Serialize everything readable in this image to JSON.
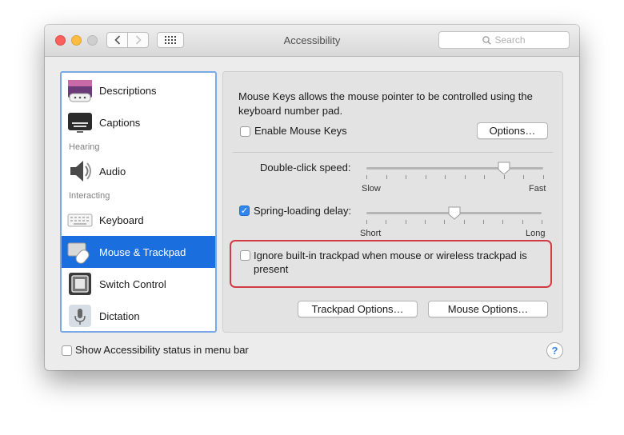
{
  "window": {
    "title": "Accessibility",
    "search_placeholder": "Search"
  },
  "sidebar": {
    "items": [
      {
        "label": "Descriptions",
        "icon": "descriptions-icon"
      },
      {
        "label": "Captions",
        "icon": "captions-icon"
      },
      {
        "label": "Audio",
        "icon": "speaker-icon"
      },
      {
        "label": "Keyboard",
        "icon": "keyboard-icon"
      },
      {
        "label": "Mouse & Trackpad",
        "icon": "mouse-trackpad-icon",
        "selected": true
      },
      {
        "label": "Switch Control",
        "icon": "switch-control-icon"
      },
      {
        "label": "Dictation",
        "icon": "microphone-icon"
      }
    ],
    "sections": {
      "hearing": "Hearing",
      "interacting": "Interacting"
    }
  },
  "main": {
    "description": "Mouse Keys allows the mouse pointer to be controlled using the keyboard number pad.",
    "enable_mouse_keys": {
      "label": "Enable Mouse Keys",
      "checked": false
    },
    "options_button": "Options…",
    "double_click": {
      "label": "Double-click speed:",
      "min_label": "Slow",
      "max_label": "Fast",
      "value": 0.78
    },
    "spring_loading": {
      "label": "Spring-loading delay:",
      "checked": true,
      "min_label": "Short",
      "max_label": "Long",
      "value": 0.5
    },
    "ignore_trackpad": {
      "label": "Ignore built-in trackpad when mouse or wireless trackpad is present",
      "checked": false
    },
    "trackpad_options_button": "Trackpad Options…",
    "mouse_options_button": "Mouse Options…"
  },
  "footer": {
    "show_status": {
      "label": "Show Accessibility status in menu bar",
      "checked": false
    },
    "help": "?"
  },
  "colors": {
    "selection": "#1b6ede",
    "highlight": "#d23a46",
    "checkbox_on": "#2f86ee"
  }
}
